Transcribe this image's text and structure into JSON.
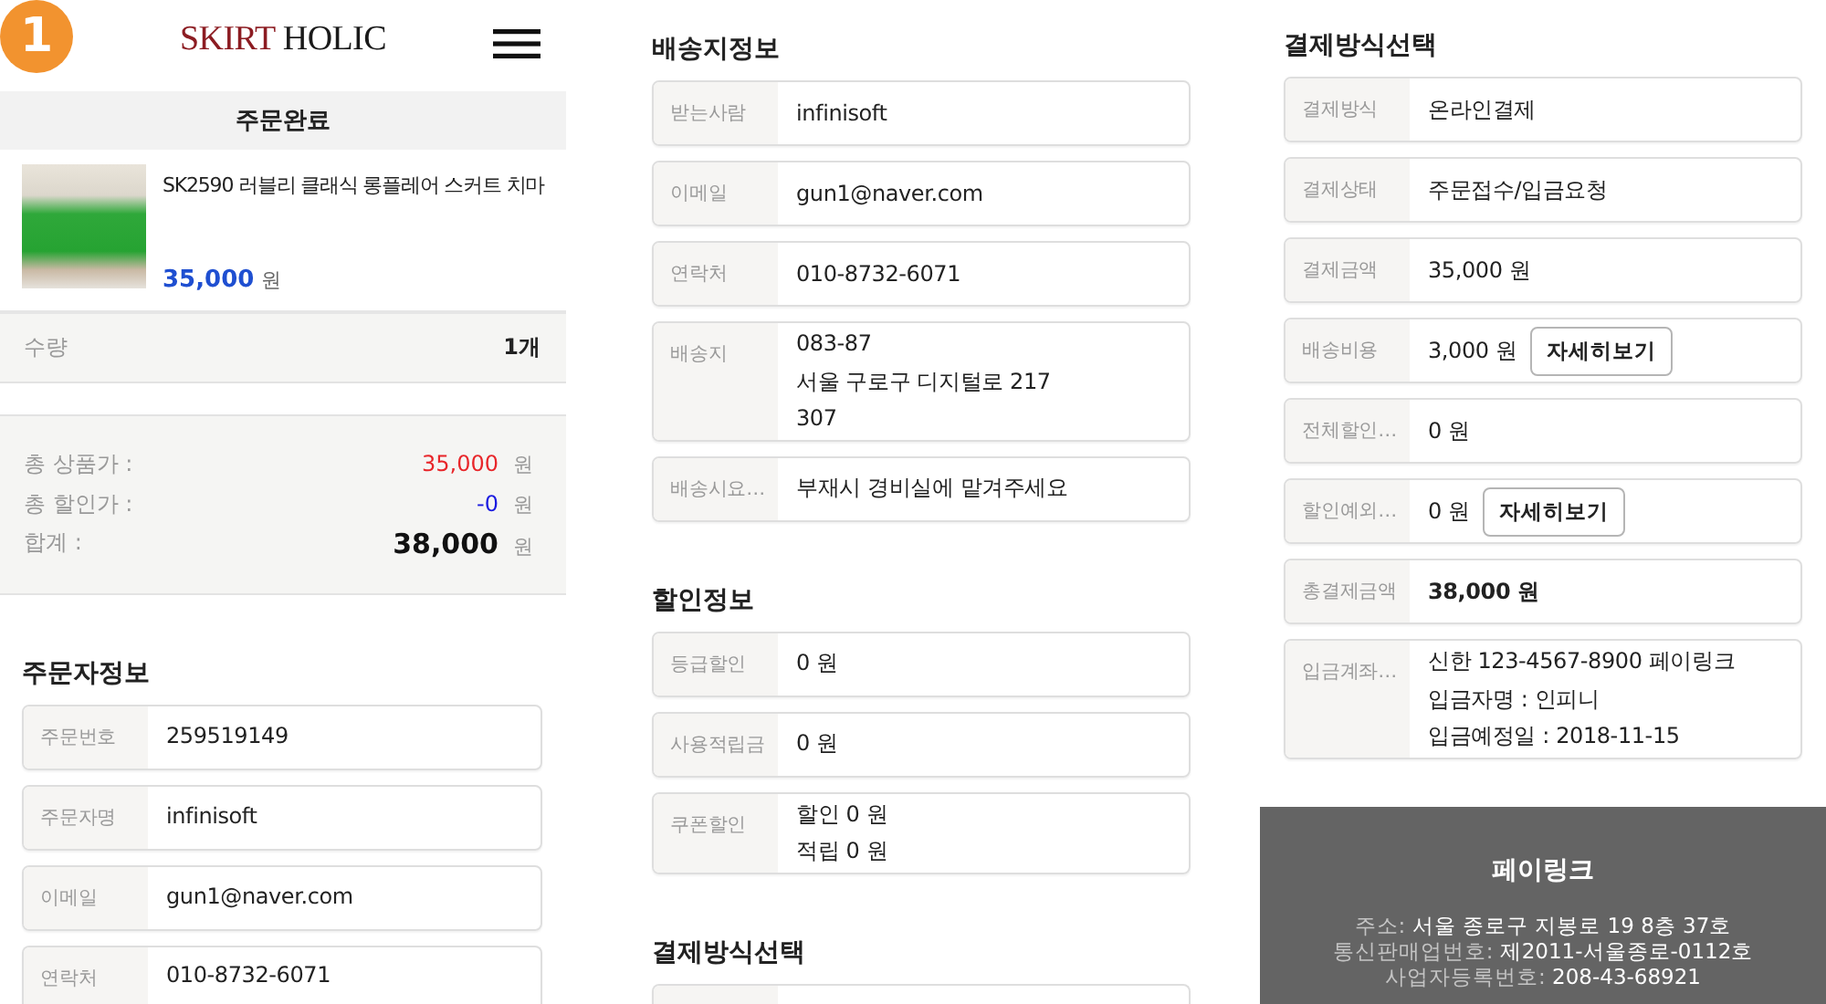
{
  "badge": "1",
  "columns": [
    {
      "header": {
        "logo_accent": "SKIRT",
        "logo_rest": "HOLIC"
      },
      "order": {
        "title": "주문완료",
        "product": {
          "name": "SK2590 러블리 클래식 롱플레어 스커트 치마",
          "price": "35,000",
          "unit": "원"
        },
        "quantity": {
          "label": "수량",
          "value": "1개"
        },
        "totals": [
          {
            "kind": "product",
            "label": "총 상품가 :",
            "value": "35,000",
            "unit": "원"
          },
          {
            "kind": "discount",
            "label": "총 할인가 :",
            "value": "-0",
            "unit": "원"
          },
          {
            "kind": "sum",
            "label": "합계 :",
            "value": "38,000",
            "unit": "원"
          }
        ]
      },
      "sections": [
        {
          "title": "주문자정보",
          "continues": false,
          "rows": [
            {
              "label": "주문번호",
              "lines": [
                "259519149"
              ],
              "emphasis": false
            },
            {
              "label": "주문자명",
              "lines": [
                "infinisoft"
              ],
              "emphasis": false
            },
            {
              "label": "이메일",
              "lines": [
                "gun1@naver.com"
              ],
              "emphasis": false
            },
            {
              "label": "연락처",
              "lines": [
                "010-8732-6071"
              ],
              "emphasis": false
            }
          ]
        }
      ]
    },
    {
      "sections": [
        {
          "title": "배송지정보",
          "continues": false,
          "rows": [
            {
              "label": "받는사람",
              "lines": [
                "infinisoft"
              ],
              "emphasis": false
            },
            {
              "label": "이메일",
              "lines": [
                "gun1@naver.com"
              ],
              "emphasis": false
            },
            {
              "label": "연락처",
              "lines": [
                "010-8732-6071"
              ],
              "emphasis": false
            },
            {
              "label": "배송지",
              "lines": [
                "083-87",
                "서울 구로구 디지털로 217",
                "307"
              ],
              "emphasis": false
            },
            {
              "label": "배송시요…",
              "lines": [
                "부재시 경비실에 맡겨주세요"
              ],
              "emphasis": false
            }
          ]
        },
        {
          "title": "할인정보",
          "continues": false,
          "rows": [
            {
              "label": "등급할인",
              "lines": [
                "0 원"
              ],
              "emphasis": false
            },
            {
              "label": "사용적립금",
              "lines": [
                "0 원"
              ],
              "emphasis": false
            },
            {
              "label": "쿠폰할인",
              "lines": [
                "할인 0 원",
                "적립 0 원"
              ],
              "emphasis": false
            }
          ]
        },
        {
          "title": "결제방식선택",
          "continues": true
        }
      ]
    },
    {
      "sections": [
        {
          "title": "결제방식선택",
          "continues": false,
          "rows": [
            {
              "label": "결제방식",
              "lines": [
                "온라인결제"
              ],
              "emphasis": false
            },
            {
              "label": "결제상태",
              "lines": [
                "주문접수/입금요청"
              ],
              "emphasis": false
            },
            {
              "label": "결제금액",
              "lines": [
                "35,000 원"
              ],
              "emphasis": false
            },
            {
              "label": "배송비용",
              "lines": [
                "3,000 원"
              ],
              "button": "자세히보기",
              "emphasis": false
            },
            {
              "label": "전체할인…",
              "lines": [
                "0 원"
              ],
              "emphasis": false
            },
            {
              "label": "할인예외…",
              "lines": [
                "0 원"
              ],
              "button": "자세히보기",
              "emphasis": false
            },
            {
              "label": "총결제금액",
              "lines": [
                "38,000 원"
              ],
              "emphasis": true
            },
            {
              "label": "입금계좌…",
              "lines": [
                "신한 123-4567-8900 페이링크",
                "입금자명 : 인피니",
                "입금예정일 : 2018-11-15"
              ],
              "emphasis": false
            }
          ]
        }
      ],
      "footer": {
        "title": "페이링크",
        "lines": [
          {
            "label": "주소:",
            "value": "서울 종로구 지봉로 19 8층 37호"
          },
          {
            "label": "통신판매업번호:",
            "value": "제2011-서울종로-0112호"
          },
          {
            "label": "사업자등록번호:",
            "value": "208-43-68921"
          }
        ]
      }
    }
  ]
}
